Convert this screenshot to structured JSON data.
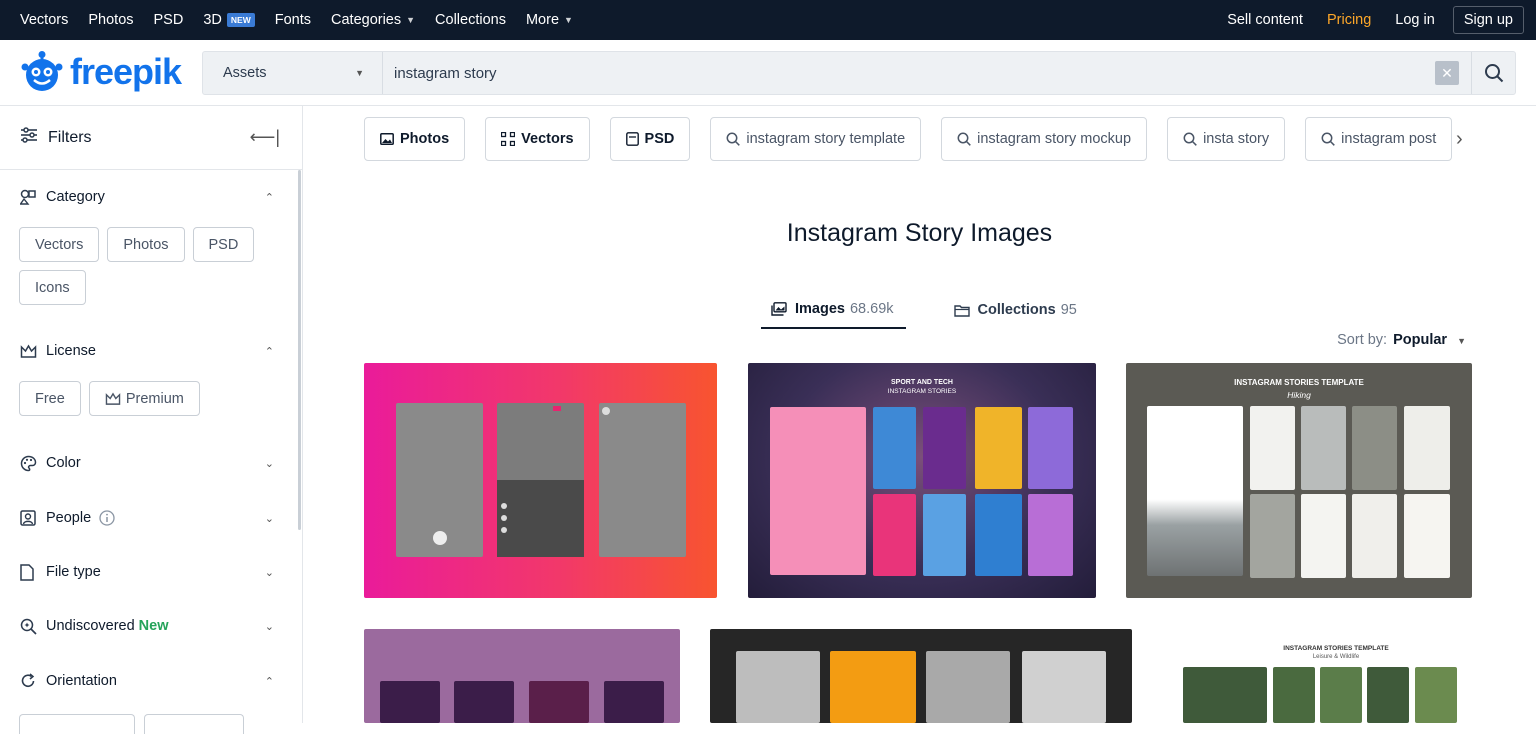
{
  "topnav": {
    "items": [
      "Vectors",
      "Photos",
      "PSD",
      "3D",
      "Fonts",
      "Categories",
      "Collections",
      "More"
    ],
    "badge_3d": "NEW",
    "sell": "Sell content",
    "pricing": "Pricing",
    "login": "Log in",
    "signup": "Sign up"
  },
  "header": {
    "logo": "freepik",
    "asset_type": "Assets",
    "query": "instagram story"
  },
  "sidebar": {
    "filters_label": "Filters",
    "category": {
      "title": "Category",
      "chips": [
        "Vectors",
        "Photos",
        "PSD",
        "Icons"
      ]
    },
    "license": {
      "title": "License",
      "chips": [
        "Free",
        "Premium"
      ]
    },
    "color": "Color",
    "people": "People",
    "file_type": "File type",
    "undiscovered": "Undiscovered",
    "undiscovered_new": "New",
    "orientation": "Orientation"
  },
  "tags": {
    "photos": "Photos",
    "vectors": "Vectors",
    "psd": "PSD",
    "s1": "instagram story template",
    "s2": "instagram story mockup",
    "s3": "insta story",
    "s4": "instagram post"
  },
  "main": {
    "title": "Instagram Story Images",
    "tab_images": "Images",
    "tab_images_count": "68.69k",
    "tab_collections": "Collections",
    "tab_collections_count": "95",
    "sort_label": "Sort by:",
    "sort_value": "Popular"
  },
  "cards": {
    "card2_title": "SPORT AND TECH",
    "card2_sub": "INSTAGRAM STORIES",
    "card3_title": "INSTAGRAM STORIES TEMPLATE",
    "card3_sub": "Hiking",
    "card6_title": "INSTAGRAM STORIES TEMPLATE",
    "card6_sub": "Leisure & Wildlife"
  },
  "colors": {
    "nav_bg": "#0e1a2b",
    "brand_blue": "#1273eb",
    "pricing": "#fda729",
    "new_green": "#25a35a"
  }
}
